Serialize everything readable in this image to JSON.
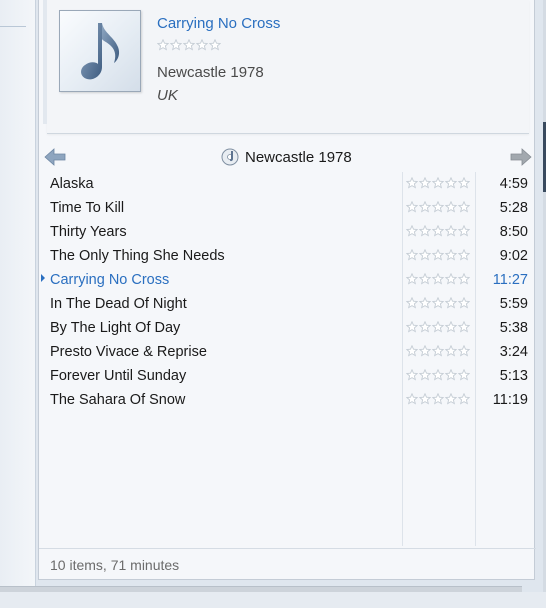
{
  "now_playing": {
    "title": "Carrying No Cross",
    "album": "Newcastle 1978",
    "artist": "UK",
    "rating": 0
  },
  "navigator": {
    "album_label": "Newcastle 1978",
    "back_icon": "back-arrow-icon",
    "forward_icon": "forward-arrow-icon"
  },
  "tracks": [
    {
      "title": "Alaska",
      "time": "4:59",
      "rating": 0
    },
    {
      "title": "Time To Kill",
      "time": "5:28",
      "rating": 0
    },
    {
      "title": "Thirty Years",
      "time": "8:50",
      "rating": 0
    },
    {
      "title": "The Only Thing She Needs",
      "time": "9:02",
      "rating": 0
    },
    {
      "title": "Carrying No Cross",
      "time": "11:27",
      "rating": 0,
      "playing": true
    },
    {
      "title": "In The Dead Of Night",
      "time": "5:59",
      "rating": 0
    },
    {
      "title": "By The Light Of Day",
      "time": "5:38",
      "rating": 0
    },
    {
      "title": "Presto Vivace & Reprise",
      "time": "3:24",
      "rating": 0
    },
    {
      "title": "Forever Until Sunday",
      "time": "5:13",
      "rating": 0
    },
    {
      "title": "The Sahara Of Snow",
      "time": "11:19",
      "rating": 0
    }
  ],
  "status": {
    "summary": "10 items, 71 minutes"
  },
  "colors": {
    "accent": "#2a6fc0",
    "text": "#1a1a1a",
    "star_outline": "#c4ccd4"
  }
}
